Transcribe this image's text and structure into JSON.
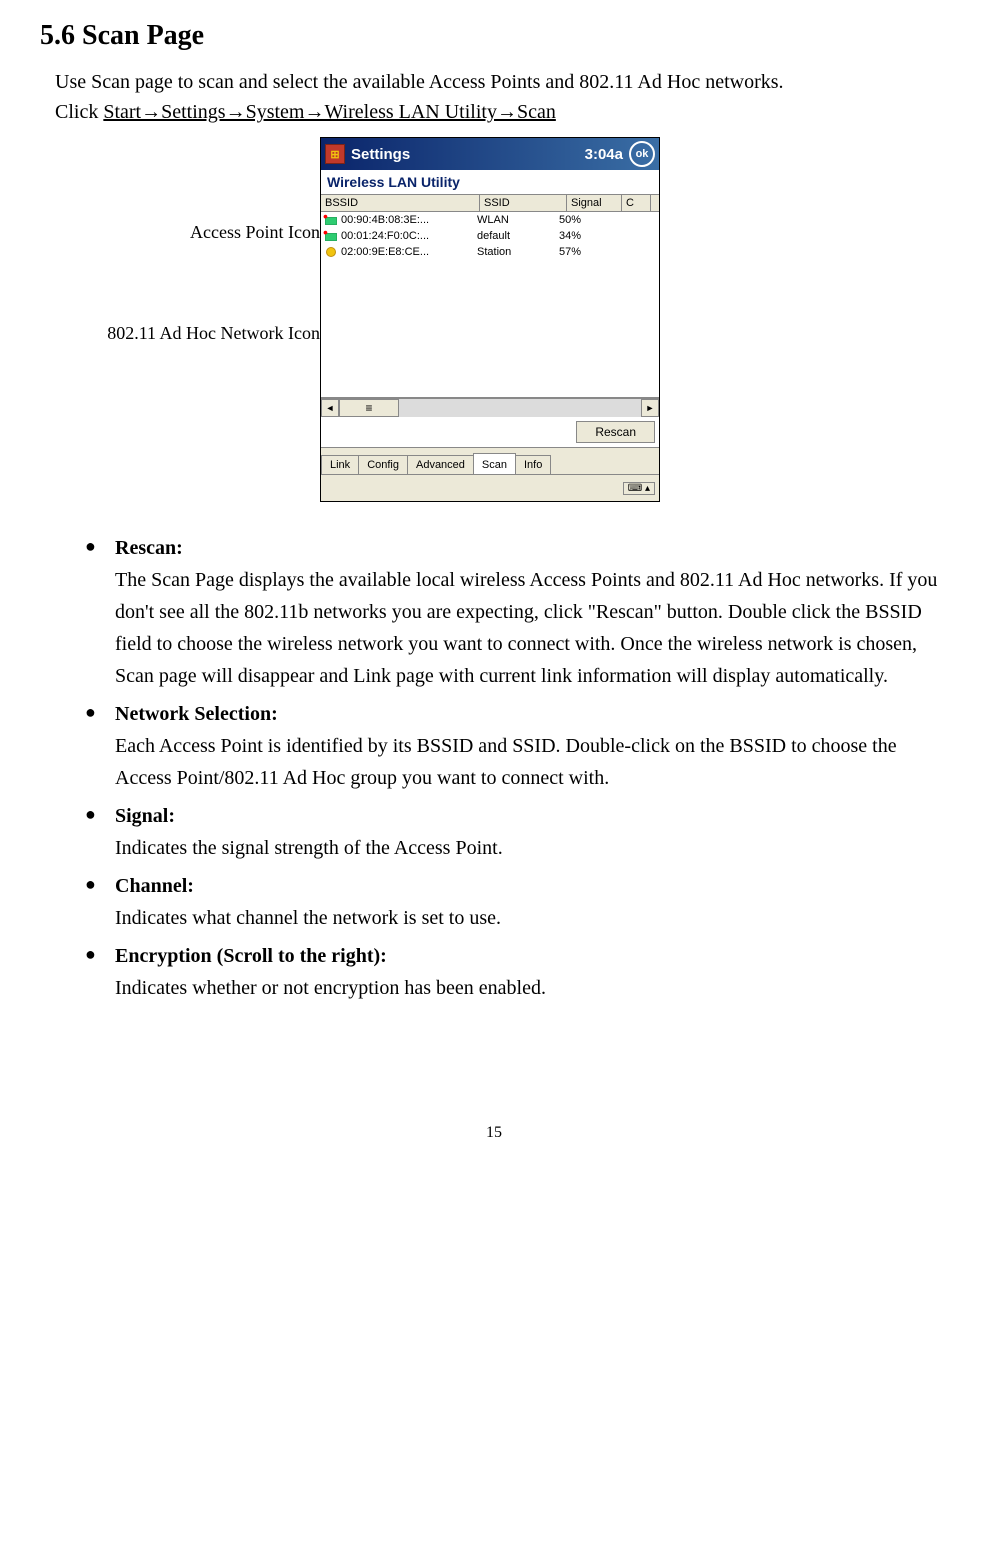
{
  "heading": "5.6 Scan Page",
  "intro_line1": "Use Scan page to scan and select the available Access Points and 802.11 Ad Hoc networks.",
  "intro_line2_prefix": "Click ",
  "intro_path": "Start→Settings→System→Wireless LAN Utility→Scan",
  "callout1": "Access Point Icon",
  "callout2": "802.11 Ad Hoc Network Icon",
  "screenshot": {
    "title_bar": "Settings",
    "time": "3:04a",
    "ok": "ok",
    "app_title": "Wireless LAN Utility",
    "headers": {
      "bssid": "BSSID",
      "ssid": "SSID",
      "signal": "Signal",
      "c": "C"
    },
    "rows": [
      {
        "type": "ap",
        "bssid": "00:90:4B:08:3E:...",
        "ssid": "WLAN",
        "signal": "50%"
      },
      {
        "type": "ap",
        "bssid": "00:01:24:F0:0C:...",
        "ssid": "default",
        "signal": "34%"
      },
      {
        "type": "adhoc",
        "bssid": "02:00:9E:E8:CE...",
        "ssid": "Station",
        "signal": "57%"
      }
    ],
    "rescan": "Rescan",
    "tabs": [
      "Link",
      "Config",
      "Advanced",
      "Scan",
      "Info"
    ],
    "active_tab": "Scan"
  },
  "bullets": [
    {
      "term": "Rescan:",
      "desc": "The Scan Page displays the available local wireless Access Points and 802.11 Ad Hoc networks.    If you don't see all the 802.11b networks you are expecting, click \"Rescan\" button.    Double click the BSSID field to choose the wireless network you want to connect with.    Once the wireless network is chosen, Scan page will disappear and Link page with current link information will display automatically."
    },
    {
      "term": "Network Selection:",
      "desc": "Each Access Point is identified by its BSSID and SSID.    Double-click on the BSSID to choose the Access Point/802.11 Ad Hoc group you want to connect with."
    },
    {
      "term": "Signal:",
      "desc": "Indicates the signal strength of the Access Point."
    },
    {
      "term": "Channel:",
      "desc": "Indicates what channel the network is set to use."
    },
    {
      "term": "Encryption (Scroll to the right):",
      "desc": "Indicates whether or not encryption has been enabled."
    }
  ],
  "page_number": "15"
}
